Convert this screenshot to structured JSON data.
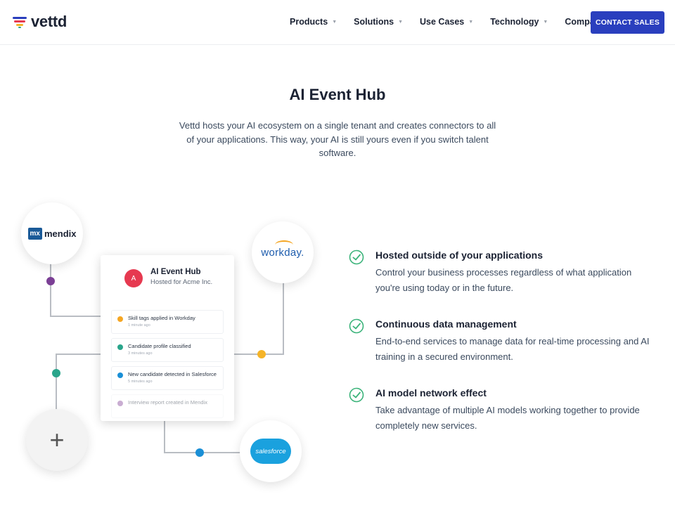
{
  "brand": {
    "name": "vettd"
  },
  "nav": {
    "items": [
      {
        "label": "Products"
      },
      {
        "label": "Solutions"
      },
      {
        "label": "Use Cases"
      },
      {
        "label": "Technology"
      },
      {
        "label": "Company"
      }
    ],
    "cta_label": "CONTACT SALES"
  },
  "intro": {
    "title": "AI Event Hub",
    "description": "Vettd hosts your AI ecosystem on a single tenant and creates connectors to all of your applications. This way, your AI is still yours even if you switch talent software."
  },
  "diagram": {
    "integrations": {
      "mendix": {
        "badge": "mx",
        "name": "mendix"
      },
      "workday": {
        "name": "workday."
      },
      "salesforce": {
        "name": "salesforce"
      },
      "add_icon": "plus-icon"
    },
    "hub": {
      "avatar": "A",
      "title": "AI Event Hub",
      "subtitle": "Hosted for Acme Inc.",
      "events": [
        {
          "title": "Skill tags applied in Workday",
          "time": "1 minute ago",
          "color": "#f5a623"
        },
        {
          "title": "Candidate profile classified",
          "time": "3 minutes ago",
          "color": "#2aa58b"
        },
        {
          "title": "New candidate detected in Salesforce",
          "time": "5 minutes ago",
          "color": "#1a8fd6"
        },
        {
          "title": "Interview report created in Mendix",
          "time": "",
          "color": "#8a4c9c"
        }
      ]
    },
    "connector_colors": {
      "purple": "#7b3f95",
      "teal": "#2aa58b",
      "orange": "#f5b428",
      "blue": "#1a8fd6"
    }
  },
  "features": [
    {
      "title": "Hosted outside of your applications",
      "description": "Control your business processes regardless of what application you're using today or in the future."
    },
    {
      "title": "Continuous data management",
      "description": "End-to-end services to manage data for real-time processing and AI training in a secured environment."
    },
    {
      "title": "AI model network effect",
      "description": "Take advantage of multiple AI models working together to provide completely new services."
    }
  ],
  "colors": {
    "accent": "#2a3fbe",
    "check": "#3bb37a"
  }
}
